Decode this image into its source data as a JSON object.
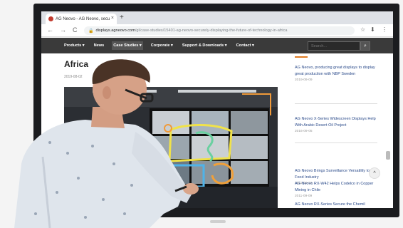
{
  "browser": {
    "tab_title": "AG Neovo - AG Neovo, secu",
    "tab_close": "×",
    "new_tab": "+",
    "url_host": "displays.agneovo.com",
    "url_path": "/gl/case-studies/15401-ag-neovo-securely-displaying-the-future-of-technology-in-africa",
    "back": "←",
    "forward": "→",
    "reload": "C"
  },
  "site_nav": {
    "items": [
      {
        "label": "Products ▾",
        "active": false
      },
      {
        "label": "News",
        "active": false
      },
      {
        "label": "Case Studies ▾",
        "active": true
      },
      {
        "label": "Corporate ▾",
        "active": false
      },
      {
        "label": "Support & Downloads ▾",
        "active": false
      },
      {
        "label": "Contact ▾",
        "active": false
      }
    ],
    "search_placeholder": "Search..."
  },
  "article": {
    "title": "Africa",
    "date": "2019-08-02"
  },
  "sidebar": {
    "items": [
      {
        "title": "AG Neovo, producing great displays to display great production with NBP Sweden",
        "date": "2019-09-09"
      },
      {
        "title": "AG Neovo X-Series Widescreen Displays Help With Arabic Desert Oil Project",
        "date": "2016-09-05"
      },
      {
        "title": "AG Neovo Brings Surveillance Versatility to the Food Industry",
        "date": "2011-02-10"
      },
      {
        "title": "AG Neovo RX-W42 Helps Codelco in Copper Mining in Chile",
        "date": "2011-09-09"
      },
      {
        "title": "AG Neovo RX-Series Secure the Chemil",
        "date": ""
      }
    ],
    "scroll_top": "^"
  },
  "colors": {
    "nav_bg": "#3a3a3a",
    "accent": "#e07b22",
    "link": "#2a4a8a",
    "bezel": "#1b1c1f"
  }
}
